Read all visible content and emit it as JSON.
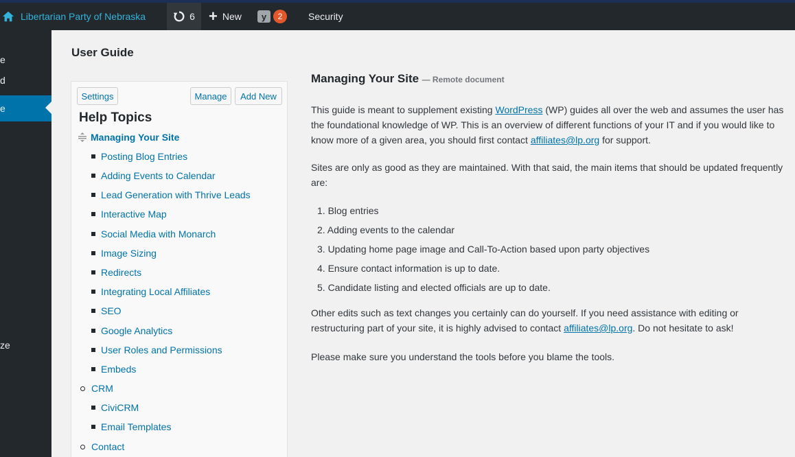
{
  "admin_bar": {
    "site_name": "Libertarian Party of Nebraska",
    "updates_count": "6",
    "new_label": "New",
    "yoast_badge": "2",
    "security_label": "Security"
  },
  "sidebar": {
    "fragments": [
      "e",
      "d",
      "e",
      "ze"
    ]
  },
  "page": {
    "title": "User Guide"
  },
  "topics": {
    "settings_button": "Settings",
    "manage_button": "Manage",
    "add_new_button": "Add New",
    "heading": "Help Topics",
    "current": "Managing Your Site",
    "sub_items": [
      "Posting Blog Entries",
      "Adding Events to Calendar",
      "Lead Generation with Thrive Leads",
      "Interactive Map",
      "Social Media with Monarch",
      "Image Sizing",
      "Redirects",
      "Integrating Local Affiliates",
      "SEO",
      "Google Analytics",
      "User Roles and Permissions",
      "Embeds"
    ],
    "crm": "CRM",
    "crm_items": [
      "CiviCRM",
      "Email Templates"
    ],
    "contact": "Contact"
  },
  "document": {
    "title": "Managing Your Site",
    "subtitle": "— Remote document",
    "p1_before_link": "This guide is meant to supplement existing ",
    "p1_link": "WordPress",
    "p1_middle": " (WP) guides all over the web and assumes the user has the foundational knowledge of WP. This is an overview of different functions of your IT and if you would like to know more of a given area, you should first contact ",
    "p1_email": "affiliates@lp.org",
    "p1_after": " for support.",
    "p2": "Sites are only as good as they are maintained. With that said, the main items that should be updated frequently are:",
    "list": [
      "1. Blog entries",
      "2. Adding events to the calendar",
      "3. Updating home page image and Call-To-Action based upon party objectives",
      "4. Ensure contact information is up to date.",
      "5. Candidate listing and elected officials are up to date."
    ],
    "p3_before": "Other edits such as text changes you certainly can do yourself. If you need assistance with editing or restructuring part of your site, it is highly advised to contact ",
    "p3_email": "affiliates@lp.org",
    "p3_after": ". Do not hesitate to ask!",
    "p4": "Please make sure you understand the tools before you blame the tools."
  },
  "colors": {
    "admin_bar": "#23282d",
    "link": "#0073aa",
    "active_menu": "#0073aa",
    "badge": "#e1582c"
  }
}
